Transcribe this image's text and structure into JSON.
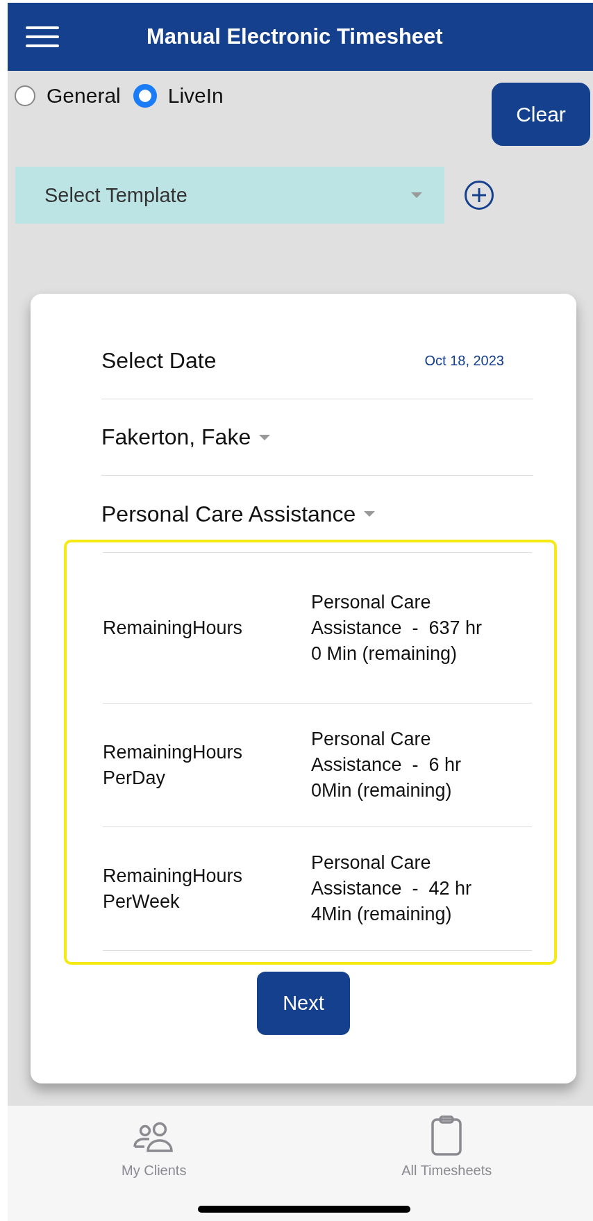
{
  "header": {
    "title": "Manual Electronic Timesheet"
  },
  "mode_options": [
    {
      "label": "General",
      "selected": false
    },
    {
      "label": "LiveIn",
      "selected": true
    }
  ],
  "clear_button": "Clear",
  "template_select": {
    "placeholder": "Select Template"
  },
  "form": {
    "date_label": "Select Date",
    "date_value": "Oct 18, 2023",
    "client": "Fakerton, Fake",
    "service": "Personal Care Assistance",
    "remaining": {
      "highlighted": true,
      "rows": [
        {
          "label": "RemainingHours",
          "value": "Personal Care Assistance  -  637 hr 0 Min (remaining)"
        },
        {
          "label": "RemainingHours PerDay",
          "value": "Personal Care Assistance  -  6 hr 0Min (remaining)"
        },
        {
          "label": "RemainingHours PerWeek",
          "value": "Personal Care Assistance  -  42 hr 4Min (remaining)"
        }
      ]
    },
    "next_button": "Next"
  },
  "tab_bar": [
    {
      "kind": "clients",
      "label": "My Clients"
    },
    {
      "kind": "timesheets",
      "label": "All Timesheets"
    }
  ]
}
